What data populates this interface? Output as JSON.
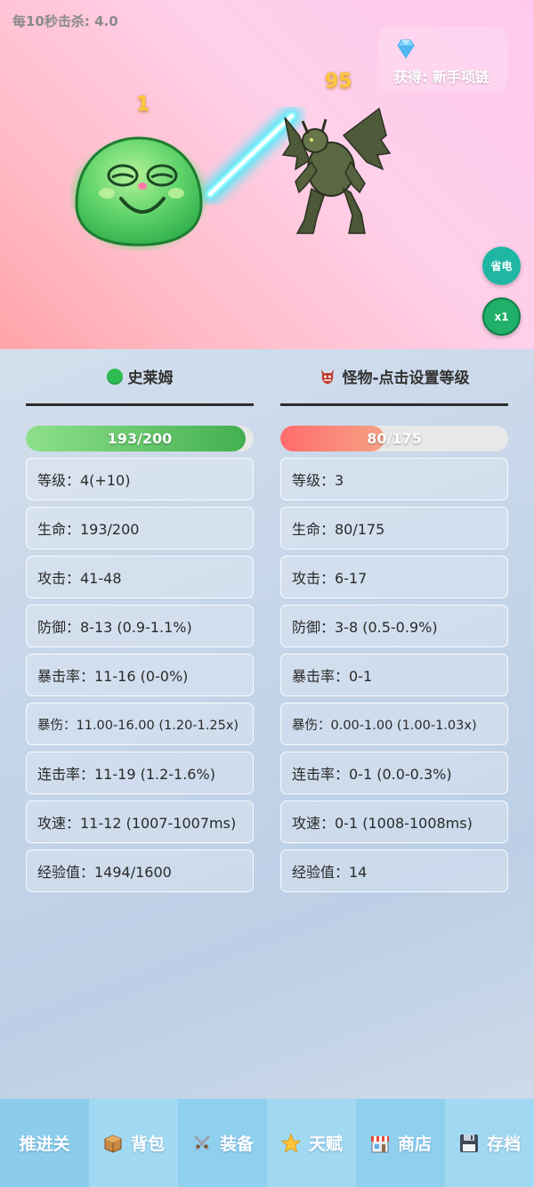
{
  "battle": {
    "kill_rate": "每10秒击杀: 4.0",
    "reward_text": "获得: 新手项链",
    "player_damage": "1",
    "enemy_damage": "95",
    "power_button": "省电",
    "speed_button": "x1"
  },
  "player": {
    "name": "史莱姆",
    "hp_text": "193/200",
    "hp_fraction": 0.965,
    "stats": [
      "等级：4(+10)",
      "生命：193/200",
      "攻击：41-48",
      "防御：8-13 (0.9-1.1%)",
      "暴击率：11-16 (0-0%)",
      "暴伤：11.00-16.00 (1.20-1.25x)",
      "连击率：11-19 (1.2-1.6%)",
      "攻速：11-12 (1007-1007ms)",
      "经验值：1494/1600"
    ]
  },
  "monster": {
    "name": "怪物-点击设置等级",
    "hp_text": "80/175",
    "hp_fraction": 0.457,
    "stats": [
      "等级：3",
      "生命：80/175",
      "攻击：6-17",
      "防御：3-8 (0.5-0.9%)",
      "暴击率：0-1",
      "暴伤：0.00-1.00 (1.00-1.03x)",
      "连击率：0-1 (0.0-0.3%)",
      "攻速：0-1 (1008-1008ms)",
      "经验值：14"
    ]
  },
  "nav": {
    "advance": "推进关",
    "bag": "背包",
    "equip": "装备",
    "talent": "天赋",
    "shop": "商店",
    "save": "存档"
  },
  "icons": {
    "gem": "diamond-icon",
    "bag": "package-icon",
    "equip": "crossed-swords-icon",
    "talent": "star-icon",
    "shop": "store-icon",
    "save": "floppy-disk-icon"
  },
  "colors": {
    "player_hp": "#43b04f",
    "monster_hp": "#ff6b6b",
    "power_button": "#1fb6a4",
    "speed_button": "#20b06a",
    "nav_bg": "#8fd0ef"
  }
}
